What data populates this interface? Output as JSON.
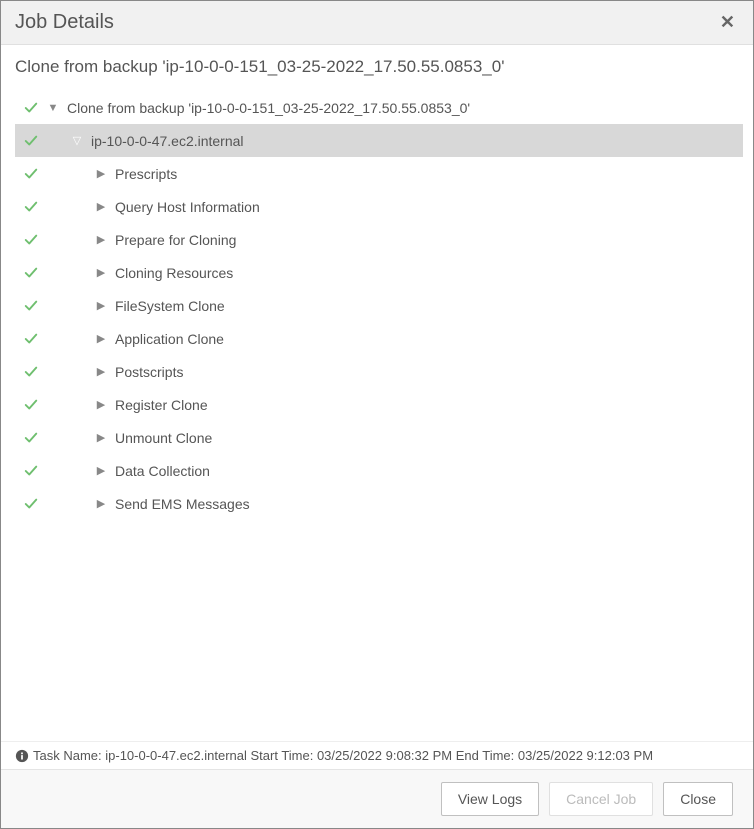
{
  "header": {
    "title": "Job Details"
  },
  "subtitle": "Clone from backup 'ip-10-0-0-151_03-25-2022_17.50.55.0853_0'",
  "tree": {
    "root_label": "Clone from backup 'ip-10-0-0-151_03-25-2022_17.50.55.0853_0'",
    "host_label": "ip-10-0-0-47.ec2.internal",
    "steps": [
      "Prescripts",
      "Query Host Information",
      "Prepare for Cloning",
      "Cloning Resources",
      "FileSystem Clone",
      "Application Clone",
      "Postscripts",
      "Register Clone",
      "Unmount Clone",
      "Data Collection",
      "Send EMS Messages"
    ]
  },
  "status_bar": {
    "text": "Task Name: ip-10-0-0-47.ec2.internal Start Time: 03/25/2022 9:08:32 PM End Time: 03/25/2022 9:12:03 PM"
  },
  "footer": {
    "view_logs": "View Logs",
    "cancel_job": "Cancel Job",
    "close": "Close"
  }
}
